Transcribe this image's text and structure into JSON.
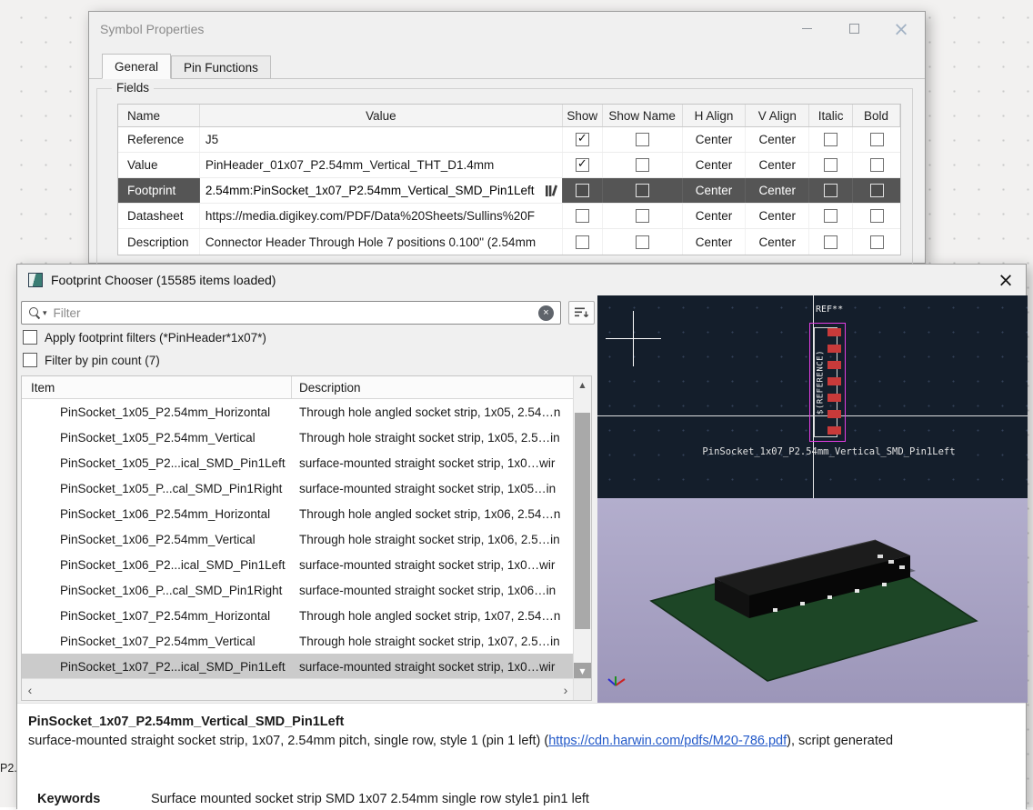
{
  "background": {
    "fragment_text": "P2."
  },
  "icons": {
    "close": "×",
    "scroll_up": "▲",
    "scroll_down": "▼",
    "scroll_left": "‹",
    "scroll_right": "›",
    "clear": "×",
    "filter_caret": "▾"
  },
  "symbol_properties": {
    "title": "Symbol Properties",
    "tabs": [
      {
        "label": "General",
        "active": true
      },
      {
        "label": "Pin Functions",
        "active": false
      }
    ],
    "fields_group": "Fields",
    "grid": {
      "columns": [
        "Name",
        "Value",
        "Show",
        "Show Name",
        "H Align",
        "V Align",
        "Italic",
        "Bold"
      ],
      "rows": [
        {
          "name": "Reference",
          "value": "J5",
          "show": true,
          "show_name": false,
          "h_align": "Center",
          "v_align": "Center",
          "italic": false,
          "bold": false,
          "selected": false
        },
        {
          "name": "Value",
          "value": "PinHeader_01x07_P2.54mm_Vertical_THT_D1.4mm",
          "show": true,
          "show_name": false,
          "h_align": "Center",
          "v_align": "Center",
          "italic": false,
          "bold": false,
          "selected": false
        },
        {
          "name": "Footprint",
          "value": "2.54mm:PinSocket_1x07_P2.54mm_Vertical_SMD_Pin1Left",
          "show": false,
          "show_name": false,
          "h_align": "Center",
          "v_align": "Center",
          "italic": false,
          "bold": false,
          "selected": true
        },
        {
          "name": "Datasheet",
          "value": "https://media.digikey.com/PDF/Data%20Sheets/Sullins%20F",
          "show": false,
          "show_name": false,
          "h_align": "Center",
          "v_align": "Center",
          "italic": false,
          "bold": false,
          "selected": false
        },
        {
          "name": "Description",
          "value": "Connector Header Through Hole 7 positions 0.100\" (2.54mm",
          "show": false,
          "show_name": false,
          "h_align": "Center",
          "v_align": "Center",
          "italic": false,
          "bold": false,
          "selected": false
        }
      ]
    }
  },
  "footprint_chooser": {
    "title": "Footprint Chooser (15585 items loaded)",
    "filter_placeholder": "Filter",
    "filters": [
      {
        "label": "Apply footprint filters (*PinHeader*1x07*)",
        "checked": false
      },
      {
        "label": "Filter by pin count (7)",
        "checked": false
      }
    ],
    "list": {
      "columns": [
        "Item",
        "Description"
      ],
      "rows": [
        {
          "item": "PinSocket_1x05_P2.54mm_Horizontal",
          "description": "Through hole angled socket strip, 1x05, 2.54…n",
          "selected": false
        },
        {
          "item": "PinSocket_1x05_P2.54mm_Vertical",
          "description": "Through hole straight socket strip, 1x05, 2.5…in",
          "selected": false
        },
        {
          "item": "PinSocket_1x05_P2...ical_SMD_Pin1Left",
          "description": "surface-mounted straight socket strip, 1x0…wir",
          "selected": false
        },
        {
          "item": "PinSocket_1x05_P...cal_SMD_Pin1Right",
          "description": "surface-mounted straight socket strip, 1x05…in",
          "selected": false
        },
        {
          "item": "PinSocket_1x06_P2.54mm_Horizontal",
          "description": "Through hole angled socket strip, 1x06, 2.54…n",
          "selected": false
        },
        {
          "item": "PinSocket_1x06_P2.54mm_Vertical",
          "description": "Through hole straight socket strip, 1x06, 2.5…in",
          "selected": false
        },
        {
          "item": "PinSocket_1x06_P2...ical_SMD_Pin1Left",
          "description": "surface-mounted straight socket strip, 1x0…wir",
          "selected": false
        },
        {
          "item": "PinSocket_1x06_P...cal_SMD_Pin1Right",
          "description": "surface-mounted straight socket strip, 1x06…in",
          "selected": false
        },
        {
          "item": "PinSocket_1x07_P2.54mm_Horizontal",
          "description": "Through hole angled socket strip, 1x07, 2.54…n",
          "selected": false
        },
        {
          "item": "PinSocket_1x07_P2.54mm_Vertical",
          "description": "Through hole straight socket strip, 1x07, 2.5…in",
          "selected": false
        },
        {
          "item": "PinSocket_1x07_P2...ical_SMD_Pin1Left",
          "description": "surface-mounted straight socket strip, 1x0…wir",
          "selected": true
        }
      ]
    },
    "preview": {
      "ref_text": "REF**",
      "reference_var": "$(REFERENCE)",
      "footprint_name": "PinSocket_1x07_P2.54mm_Vertical_SMD_Pin1Left"
    },
    "details": {
      "name": "PinSocket_1x07_P2.54mm_Vertical_SMD_Pin1Left",
      "desc_before_link": "surface-mounted straight socket strip, 1x07, 2.54mm pitch, single row, style 1 (pin 1 left) (",
      "link_text": "https://cdn.harwin.com/pdfs/M20-786.pdf",
      "desc_after_link": "), script generated",
      "keywords_label": "Keywords",
      "keywords_value": "Surface mounted socket strip SMD 1x07 2.54mm single row style1 pin1 left"
    },
    "colors": {
      "selection_dark": "#555555",
      "selection_light": "#cbcbcb",
      "pad_red": "#c83a3a",
      "courtyard_magenta": "#e23ee2",
      "preview_bg": "#141e2b",
      "view3d_bg": "#aaa4c3",
      "board_green": "#1d4626",
      "link_blue": "#2158c8"
    }
  }
}
